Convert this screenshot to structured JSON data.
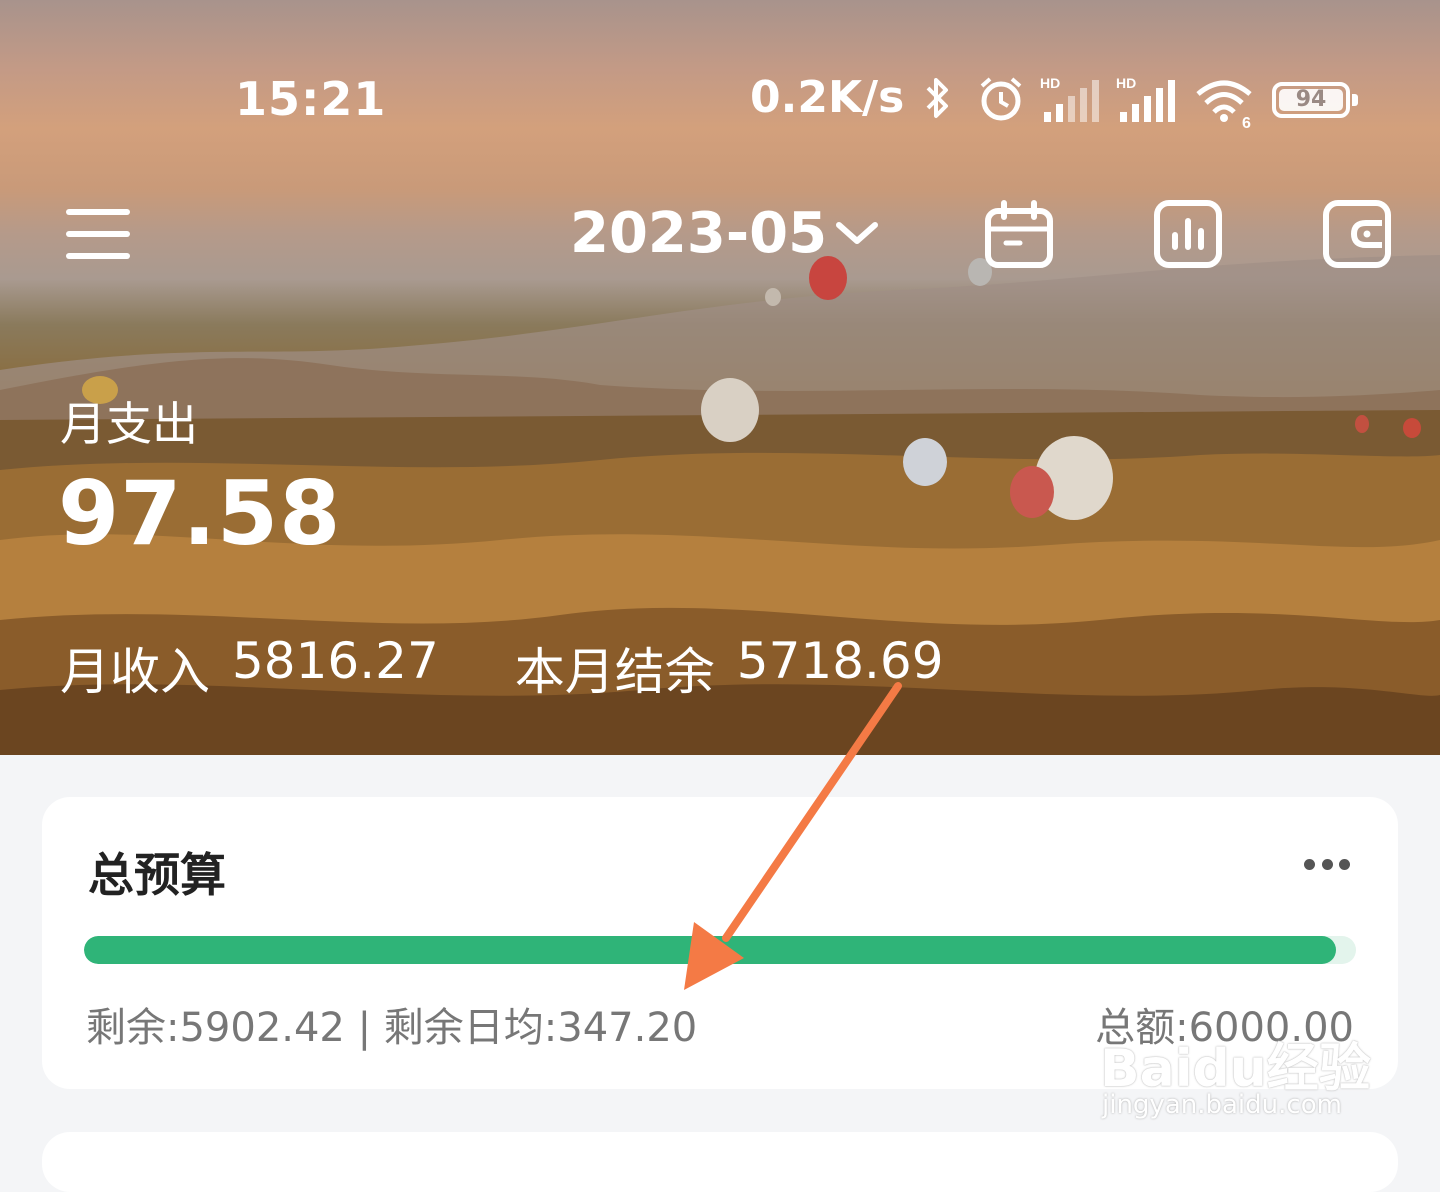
{
  "status_bar": {
    "time": "15:21",
    "net_speed": "0.2K/s",
    "battery": "94",
    "icons": [
      "bluetooth-icon",
      "alarm-icon",
      "signal-hd-icon",
      "signal-hd-icon",
      "wifi-icon",
      "battery-icon"
    ]
  },
  "toolbar": {
    "month": "2023-05",
    "icons": [
      "menu-icon",
      "calendar-icon",
      "chart-icon",
      "wallet-icon"
    ]
  },
  "summary": {
    "expense_label": "月支出",
    "expense_value": "97.58",
    "income_label": "月收入",
    "income_value": "5816.27",
    "balance_label": "本月结余",
    "balance_value": "5718.69"
  },
  "budget": {
    "title": "总预算",
    "remaining_text": "剩余:5902.42 | 剩余日均:347.20",
    "total_text": "总额:6000.00",
    "remaining_fraction": 0.984
  },
  "watermark": {
    "brand": "Baidu经验",
    "url": "jingyan.baidu.com"
  },
  "colors": {
    "progress": "#2fb478",
    "arrow": "#f47a45"
  }
}
